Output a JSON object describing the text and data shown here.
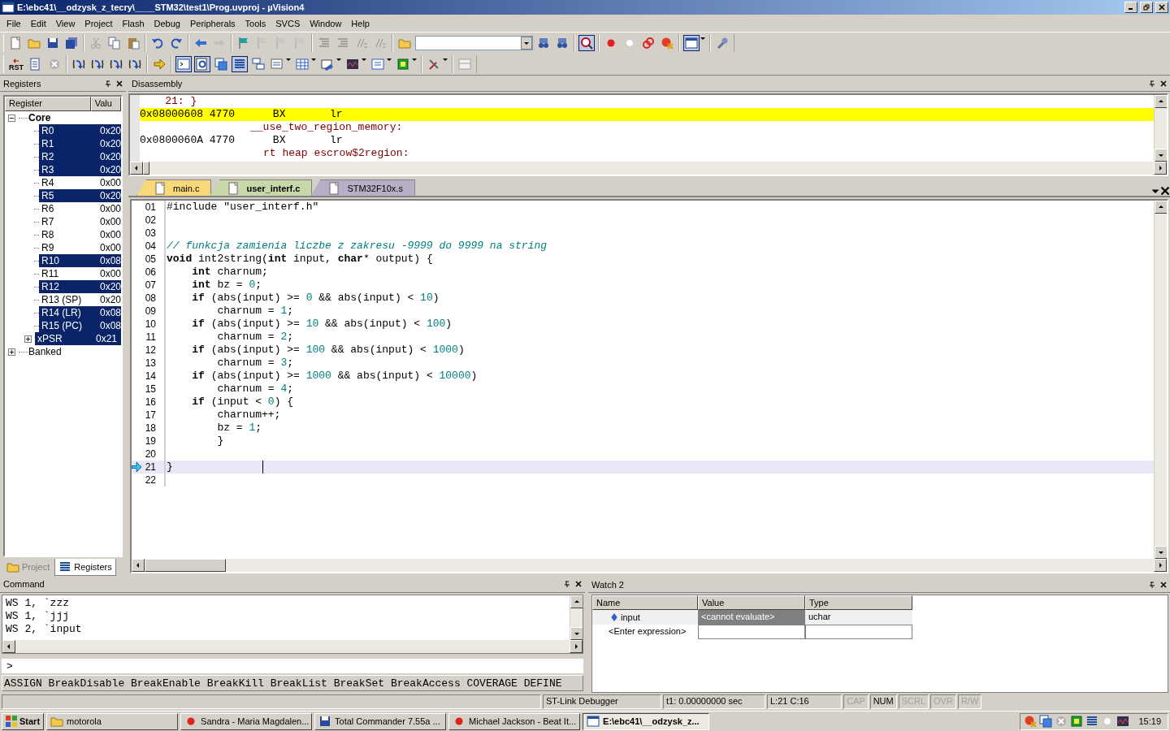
{
  "window": {
    "title": "E:\\ebc41\\__odzysk_z_tecry\\____STM32\\test1\\Prog.uvproj - µVision4"
  },
  "menu": [
    "File",
    "Edit",
    "View",
    "Project",
    "Flash",
    "Debug",
    "Peripherals",
    "Tools",
    "SVCS",
    "Window",
    "Help"
  ],
  "toolbar": {
    "reset_label": "RST",
    "toggles": {
      "debug": true,
      "window_layout": true,
      "command_window": true,
      "disassembly_window": true,
      "symbols_window": false,
      "registers_window": true
    }
  },
  "registers": {
    "title": "Registers",
    "columns": [
      "Register",
      "Valu"
    ],
    "tree": [
      {
        "name": "Core",
        "expanded": true,
        "children": [
          {
            "name": "R0",
            "value": "0x20",
            "selected": true
          },
          {
            "name": "R1",
            "value": "0x20",
            "selected": true
          },
          {
            "name": "R2",
            "value": "0x20",
            "selected": true
          },
          {
            "name": "R3",
            "value": "0x20",
            "selected": true
          },
          {
            "name": "R4",
            "value": "0x00",
            "selected": false
          },
          {
            "name": "R5",
            "value": "0x20",
            "selected": true
          },
          {
            "name": "R6",
            "value": "0x00",
            "selected": false
          },
          {
            "name": "R7",
            "value": "0x00",
            "selected": false
          },
          {
            "name": "R8",
            "value": "0x00",
            "selected": false
          },
          {
            "name": "R9",
            "value": "0x00",
            "selected": false
          },
          {
            "name": "R10",
            "value": "0x08",
            "selected": true
          },
          {
            "name": "R11",
            "value": "0x00",
            "selected": false
          },
          {
            "name": "R12",
            "value": "0x20",
            "selected": true
          },
          {
            "name": "R13 (SP)",
            "value": "0x20",
            "selected": false
          },
          {
            "name": "R14 (LR)",
            "value": "0x08",
            "selected": true
          },
          {
            "name": "R15 (PC)",
            "value": "0x08",
            "selected": true
          },
          {
            "name": "xPSR",
            "value": "0x21",
            "selected": true,
            "expanded": false
          }
        ]
      },
      {
        "name": "Banked",
        "expanded": false
      }
    ],
    "tabs": [
      {
        "label": "Project",
        "selected": false
      },
      {
        "label": "Registers",
        "selected": true
      }
    ]
  },
  "disassembly": {
    "title": "Disassembly",
    "lines": [
      {
        "kind": "source",
        "text": "    21: }"
      },
      {
        "kind": "code",
        "address": "0x08000608",
        "opcode": "4770",
        "mnemonic": "BX",
        "operand": "lr",
        "current": true
      },
      {
        "kind": "label",
        "text": "__use_two_region_memory:"
      },
      {
        "kind": "code",
        "address": "0x0800060A",
        "opcode": "4770",
        "mnemonic": "BX",
        "operand": "lr",
        "current": false
      },
      {
        "kind": "label",
        "text": "rt heap escrow$2region:"
      }
    ]
  },
  "editor": {
    "tabs": [
      {
        "label": "main.c",
        "color": "#f8d878",
        "selected": false
      },
      {
        "label": "user_interf.c",
        "color": "#c8d8a8",
        "selected": true
      },
      {
        "label": "STM32F10x.s",
        "color": "#b8aec8",
        "selected": false
      }
    ],
    "lines": [
      {
        "number": "01",
        "text": "#include \"user_interf.h\""
      },
      {
        "number": "02"
      },
      {
        "number": "03"
      },
      {
        "number": "04",
        "kind": "comment",
        "text": "// funkcja zamienia liczbe z zakresu -9999 do 9999 na string"
      },
      {
        "number": "05",
        "text": "**void** int2string(**int** input, **char*** output) {"
      },
      {
        "number": "06",
        "text": "    **int** charnum;"
      },
      {
        "number": "07",
        "text": "    **int** bz = 0;"
      },
      {
        "number": "08",
        "text": "    **if** (abs(input) >= 0 && abs(input) < 10)"
      },
      {
        "number": "09",
        "text": "        charnum = 1;"
      },
      {
        "number": "10",
        "text": "    **if** (abs(input) >= 10 && abs(input) < 100)"
      },
      {
        "number": "11",
        "text": "        charnum = 2;"
      },
      {
        "number": "12",
        "text": "    **if** (abs(input) >= 100 && abs(input) < 1000)"
      },
      {
        "number": "13",
        "text": "        charnum = 3;"
      },
      {
        "number": "14",
        "text": "    **if** (abs(input) >= 1000 && abs(input) < 10000)"
      },
      {
        "number": "15",
        "text": "        charnum = 4;"
      },
      {
        "number": "16",
        "text": "    **if** (input < 0) {"
      },
      {
        "number": "17",
        "text": "        charnum++;"
      },
      {
        "number": "18",
        "text": "        bz = 1;"
      },
      {
        "number": "19",
        "text": "        }"
      },
      {
        "number": "20"
      },
      {
        "number": "21",
        "text": "}",
        "current": true
      },
      {
        "number": "22"
      }
    ]
  },
  "command": {
    "title": "Command",
    "lines": [
      "WS 1, `zzz",
      "WS 1, `jjj",
      "WS 2, `input"
    ],
    "prompt": ">",
    "help": "ASSIGN BreakDisable BreakEnable BreakKill BreakList BreakSet BreakAccess COVERAGE DEFINE"
  },
  "watch": {
    "title": "Watch 2",
    "columns": [
      "Name",
      "Value",
      "Type"
    ],
    "rows": [
      {
        "kind": "variable",
        "name": "input",
        "value": "<cannot evaluate>",
        "type": "uchar",
        "selected": true
      },
      {
        "kind": "entry",
        "name": "<Enter expression>"
      }
    ]
  },
  "status_bar": {
    "fields": [
      "ST-Link Debugger",
      "t1: 0.00000000 sec",
      "L:21 C:16"
    ],
    "indicators": [
      {
        "label": "CAP",
        "on": false
      },
      {
        "label": "NUM",
        "on": true
      },
      {
        "label": "SCRL",
        "on": false
      },
      {
        "label": "OVR",
        "on": false
      },
      {
        "label": "R/W",
        "on": false
      }
    ]
  },
  "taskbar": {
    "start": "Start",
    "tasks": [
      {
        "label": "motorola",
        "kind": "folder",
        "selected": false
      },
      {
        "label": "Sandra - Maria Magdalen...",
        "kind": "browser",
        "selected": false
      },
      {
        "label": "Total Commander 7.55a ...",
        "kind": "disk",
        "selected": false
      },
      {
        "label": "Michael Jackson - Beat It...",
        "kind": "browser",
        "selected": false
      },
      {
        "label": "E:\\ebc41\\__odzysk_z...",
        "kind": "app",
        "selected": true
      }
    ],
    "clock": "15:19"
  }
}
